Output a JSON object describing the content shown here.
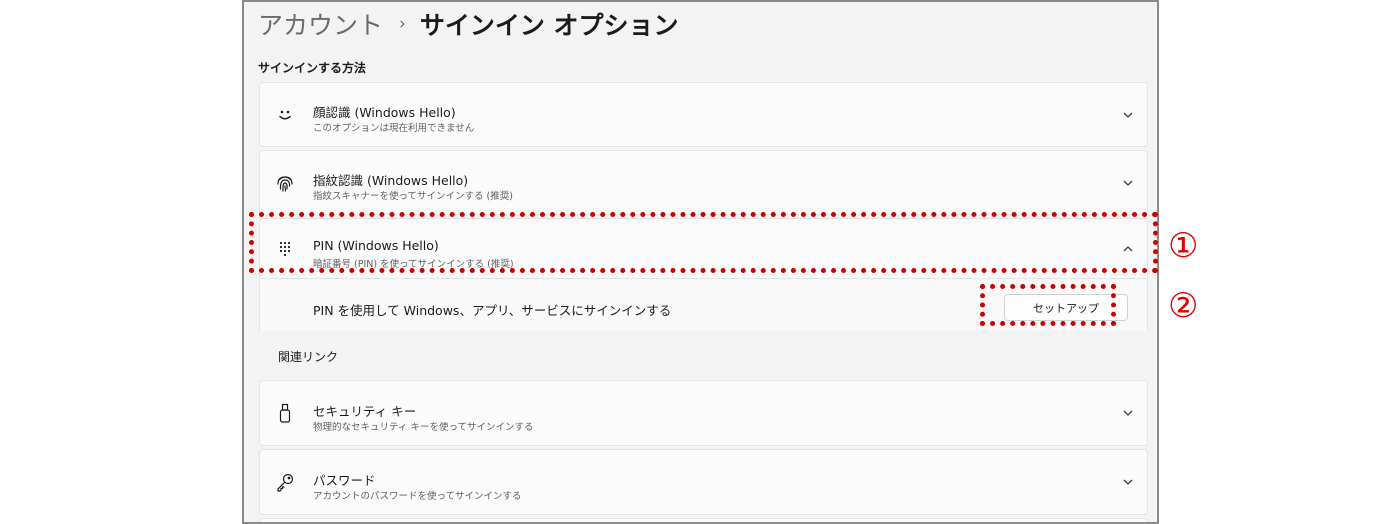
{
  "header": {
    "parent": "アカウント",
    "separator": "›",
    "current": "サインイン オプション"
  },
  "section": {
    "label": "サインインする方法"
  },
  "options": [
    {
      "title": "顔認識 (Windows Hello)",
      "subtitle": "このオプションは現在利用できません",
      "icon": "face-icon",
      "expanded": false
    },
    {
      "title": "指紋認識 (Windows Hello)",
      "subtitle": "指紋スキャナーを使ってサインインする (推奨)",
      "icon": "fingerprint-icon",
      "expanded": false
    },
    {
      "title": "PIN (Windows Hello)",
      "subtitle": "暗証番号 (PIN) を使ってサインインする (推奨)",
      "icon": "keypad-icon",
      "expanded": true
    }
  ],
  "pin_panel": {
    "description": "PIN を使用して Windows、アプリ、サービスにサインインする",
    "setup_button": "セットアップ"
  },
  "related": {
    "label": "関連リンク"
  },
  "related_items": [
    {
      "title": "セキュリティ キー",
      "subtitle": "物理的なセキュリティ キーを使ってサインインする",
      "icon": "usb-key-icon"
    },
    {
      "title": "パスワード",
      "subtitle": "アカウントのパスワードを使ってサインインする",
      "icon": "key-icon"
    }
  ],
  "annotations": {
    "marker_1": "①",
    "marker_2": "②",
    "color": "#cc0000"
  }
}
